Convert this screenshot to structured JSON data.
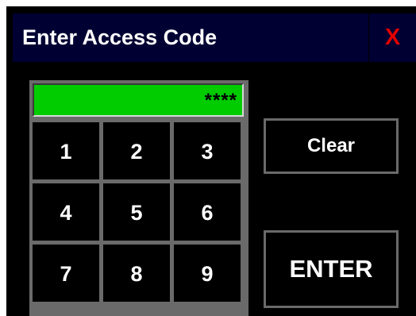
{
  "dialog": {
    "title": "Enter Access Code",
    "close_label": "X"
  },
  "display": {
    "masked_code": "****"
  },
  "keypad": {
    "keys": [
      "1",
      "2",
      "3",
      "4",
      "5",
      "6",
      "7",
      "8",
      "9"
    ]
  },
  "actions": {
    "clear_label": "Clear",
    "enter_label": "ENTER"
  },
  "colors": {
    "titlebar": "#000033",
    "background": "#000000",
    "display": "#00cc00",
    "close": "#e00000",
    "grid": "#6a6a6a"
  }
}
